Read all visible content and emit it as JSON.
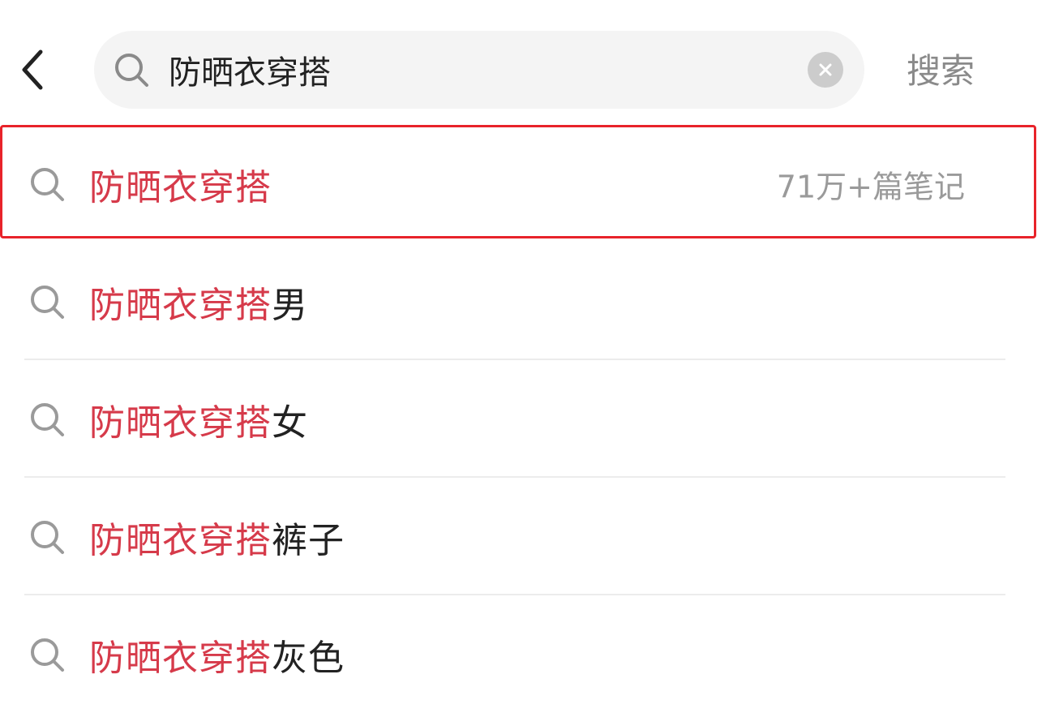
{
  "colors": {
    "highlight_text": "#d63a4a",
    "normal_text": "#222222",
    "muted_text": "#8a8a8a",
    "annotation_box": "#e8232a",
    "search_bg": "#f4f4f4"
  },
  "header": {
    "back_icon": "chevron-left-icon",
    "search_icon": "search-icon",
    "query_value": "防晒衣穿搭",
    "clear_icon": "close-icon",
    "search_button_label": "搜索"
  },
  "suggestions": [
    {
      "highlight": "防晒衣穿搭",
      "rest": "",
      "count": "71万+篇笔记",
      "selected": true
    },
    {
      "highlight": "防晒衣穿搭",
      "rest": "男",
      "count": ""
    },
    {
      "highlight": "防晒衣穿搭",
      "rest": "女",
      "count": ""
    },
    {
      "highlight": "防晒衣穿搭",
      "rest": "裤子",
      "count": ""
    },
    {
      "highlight": "防晒衣穿搭",
      "rest": "灰色",
      "count": ""
    }
  ]
}
